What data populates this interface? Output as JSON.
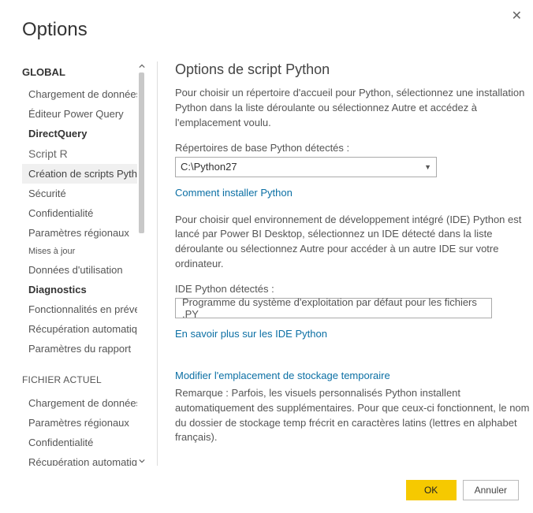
{
  "dialog": {
    "title": "Options"
  },
  "sidebar": {
    "global_header": "GLOBAL",
    "items": [
      "Chargement de données",
      "Éditeur Power Query",
      "DirectQuery",
      "Script R",
      "Création de scripts Python",
      "Sécurité",
      "Confidentialité",
      "Paramètres régionaux",
      "Mises à jour",
      "Données d'utilisation",
      "Diagnostics",
      "Fonctionnalités en préversion",
      "Récupération automatique",
      "Paramètres du rapport"
    ],
    "file_header": "FICHIER ACTUEL",
    "file_items": [
      "Chargement de données",
      "Paramètres régionaux",
      "Confidentialité",
      "Récupération automatique"
    ]
  },
  "content": {
    "title": "Options de script Python",
    "intro": "Pour choisir un répertoire d'accueil pour Python, sélectionnez une installation Python dans la liste déroulante ou sélectionnez Autre et accédez à l'emplacement voulu.",
    "repo_label": "Répertoires de base Python détectés :",
    "repo_value": "C:\\Python27",
    "install_link": "Comment installer Python",
    "ide_intro": "Pour choisir quel environnement de développement intégré (IDE) Python est lancé par Power BI Desktop, sélectionnez un IDE détecté dans la liste déroulante ou sélectionnez Autre pour accéder à un autre IDE sur votre ordinateur.",
    "ide_label": "IDE Python détectés :",
    "ide_value": "Programme du système d'exploitation par défaut pour les fichiers .PY",
    "ide_link": "En savoir plus sur les IDE Python",
    "storage_link": "Modifier l'emplacement de stockage temporaire",
    "remark": "Remarque : Parfois, les visuels personnalisés Python installent automatiquement des supplémentaires. Pour que ceux-ci fonctionnent, le nom du dossier de stockage temp frécrit en caractères latins (lettres en alphabet français)."
  },
  "footer": {
    "ok": "OK",
    "cancel": "Annuler"
  }
}
